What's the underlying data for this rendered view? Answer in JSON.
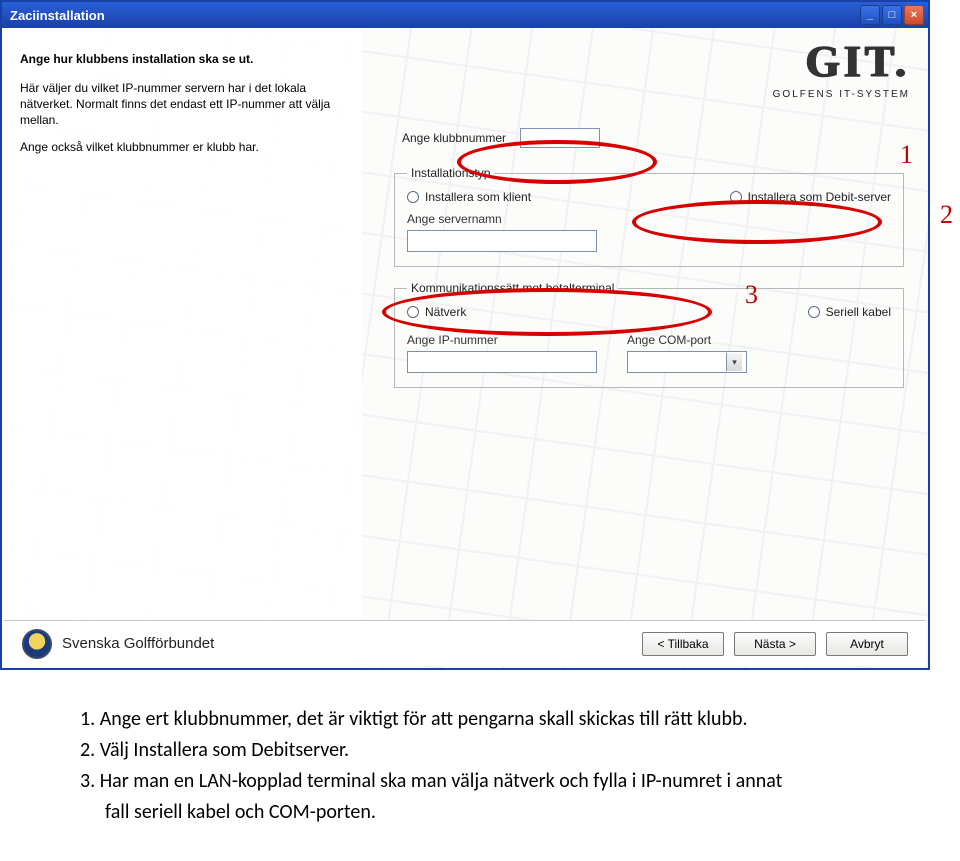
{
  "window": {
    "title": "Zaciinstallation"
  },
  "logo": {
    "big": "GIT.",
    "sub": "GOLFENS IT-SYSTEM"
  },
  "left": {
    "heading": "Ange hur klubbens installation ska se ut.",
    "p1": "Här väljer du vilket IP-nummer servern har i det lokala nätverket. Normalt finns det endast ett IP-nummer att välja mellan.",
    "p2": "Ange också vilket klubbnummer er klubb har."
  },
  "form": {
    "klubbnummer_label": "Ange klubbnummer",
    "klubbnummer_value": "",
    "installtype_legend": "Installationstyp",
    "radio_klient": "Installera som klient",
    "radio_debit": "Installera som Debit-server",
    "servernamn_label": "Ange servernamn",
    "servernamn_value": "",
    "komm_legend": "Kommunikationssätt mot betalterminal",
    "radio_natverk": "Nätverk",
    "radio_seriell": "Seriell kabel",
    "ip_label": "Ange IP-nummer",
    "ip_value": "",
    "com_label": "Ange COM-port",
    "com_value": ""
  },
  "footer": {
    "org": "Svenska Golfförbundet",
    "back": "< Tillbaka",
    "next": "Nästa >",
    "cancel": "Avbryt"
  },
  "annotations": {
    "n1": "1",
    "n2": "2",
    "n3": "3"
  },
  "instructions": {
    "i1": "1. Ange ert klubbnummer, det är viktigt för att pengarna skall skickas till rätt klubb.",
    "i2": "2. Välj Installera som Debitserver.",
    "i3": "3. Har man en LAN-kopplad terminal ska man välja nätverk och fylla i IP-numret i annat",
    "i3b": "fall seriell kabel och COM-porten."
  }
}
